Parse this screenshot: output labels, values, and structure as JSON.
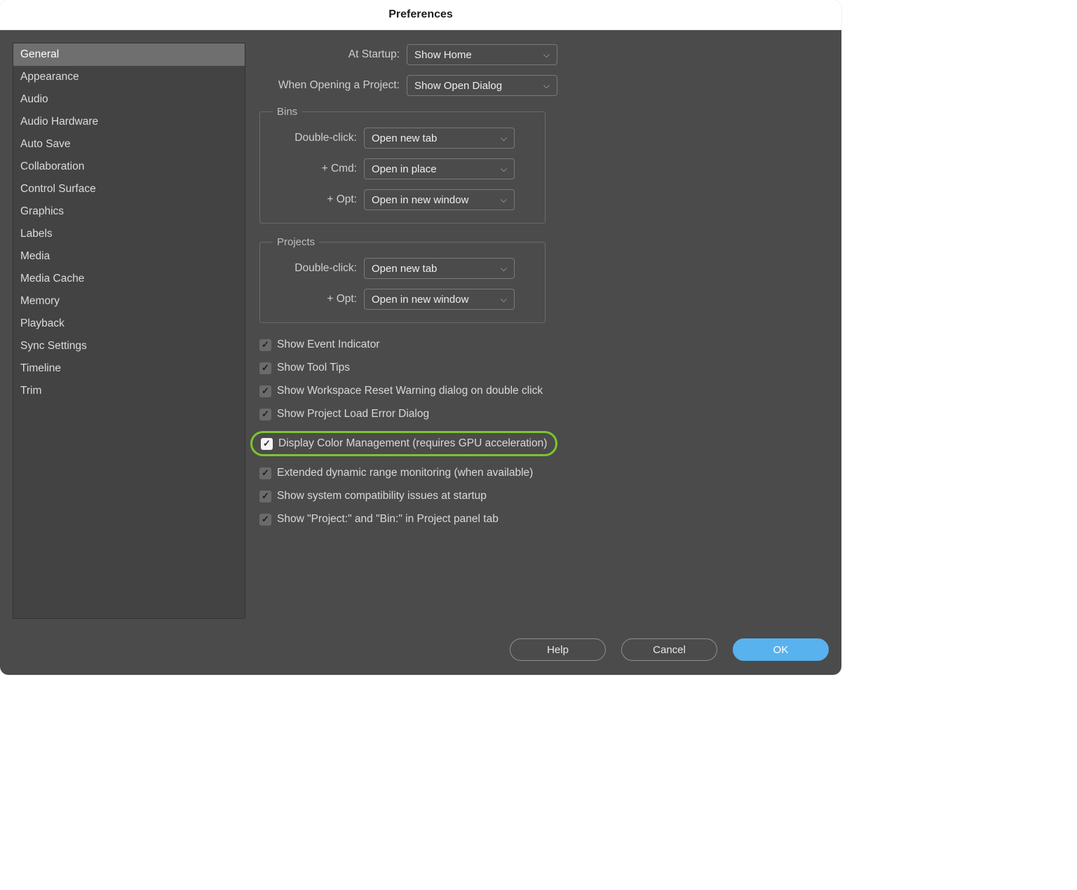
{
  "title": "Preferences",
  "sidebar": {
    "items": [
      "General",
      "Appearance",
      "Audio",
      "Audio Hardware",
      "Auto Save",
      "Collaboration",
      "Control Surface",
      "Graphics",
      "Labels",
      "Media",
      "Media Cache",
      "Memory",
      "Playback",
      "Sync Settings",
      "Timeline",
      "Trim"
    ],
    "selected_index": 0
  },
  "top": {
    "startup_label": "At Startup:",
    "startup_value": "Show Home",
    "open_label": "When Opening a Project:",
    "open_value": "Show Open Dialog"
  },
  "bins": {
    "legend": "Bins",
    "dbl_label": "Double-click:",
    "dbl_value": "Open new tab",
    "cmd_label": "+ Cmd:",
    "cmd_value": "Open in place",
    "opt_label": "+ Opt:",
    "opt_value": "Open in new window"
  },
  "projects": {
    "legend": "Projects",
    "dbl_label": "Double-click:",
    "dbl_value": "Open new tab",
    "opt_label": "+ Opt:",
    "opt_value": "Open in new window"
  },
  "checks": {
    "c0": "Show Event Indicator",
    "c1": "Show Tool Tips",
    "c2": "Show Workspace Reset Warning dialog on double click",
    "c3": "Show Project Load Error Dialog",
    "c4": "Display Color Management (requires GPU acceleration)",
    "c5": "Extended dynamic range monitoring (when available)",
    "c6": "Show system compatibility issues at startup",
    "c7": "Show \"Project:\" and \"Bin:\" in Project panel tab"
  },
  "footer": {
    "help": "Help",
    "cancel": "Cancel",
    "ok": "OK"
  }
}
